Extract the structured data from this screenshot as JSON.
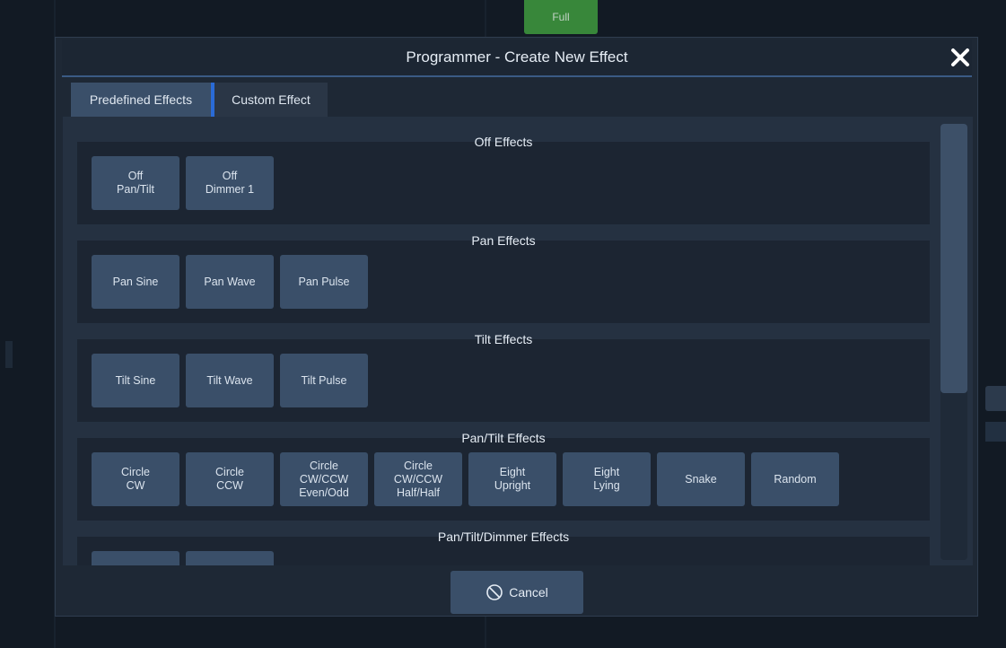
{
  "background": {
    "top_button_label": "Full"
  },
  "dialog": {
    "title": "Programmer - Create New Effect",
    "close_icon": "close-icon"
  },
  "tabs": [
    {
      "label": "Predefined Effects",
      "active": true
    },
    {
      "label": "Custom Effect",
      "active": false
    }
  ],
  "groups": [
    {
      "title": "Off Effects",
      "buttons": [
        "Off\nPan/Tilt",
        "Off\nDimmer 1"
      ]
    },
    {
      "title": "Pan Effects",
      "buttons": [
        "Pan Sine",
        "Pan Wave",
        "Pan Pulse"
      ]
    },
    {
      "title": "Tilt Effects",
      "buttons": [
        "Tilt Sine",
        "Tilt Wave",
        "Tilt Pulse"
      ]
    },
    {
      "title": "Pan/Tilt Effects",
      "buttons": [
        "Circle\nCW",
        "Circle\nCCW",
        "Circle\nCW/CCW\nEven/Odd",
        "Circle\nCW/CCW\nHalf/Half",
        "Eight\nUpright",
        "Eight\nLying",
        "Snake",
        "Random"
      ]
    },
    {
      "title": "Pan/Tilt/Dimmer Effects",
      "buttons": [
        "",
        ""
      ]
    }
  ],
  "footer": {
    "cancel_label": "Cancel",
    "cancel_icon": "cancel-circle-icon"
  },
  "colors": {
    "accent": "#2a6bd6",
    "button": "#3a4f69",
    "panel": "#1c2532"
  }
}
